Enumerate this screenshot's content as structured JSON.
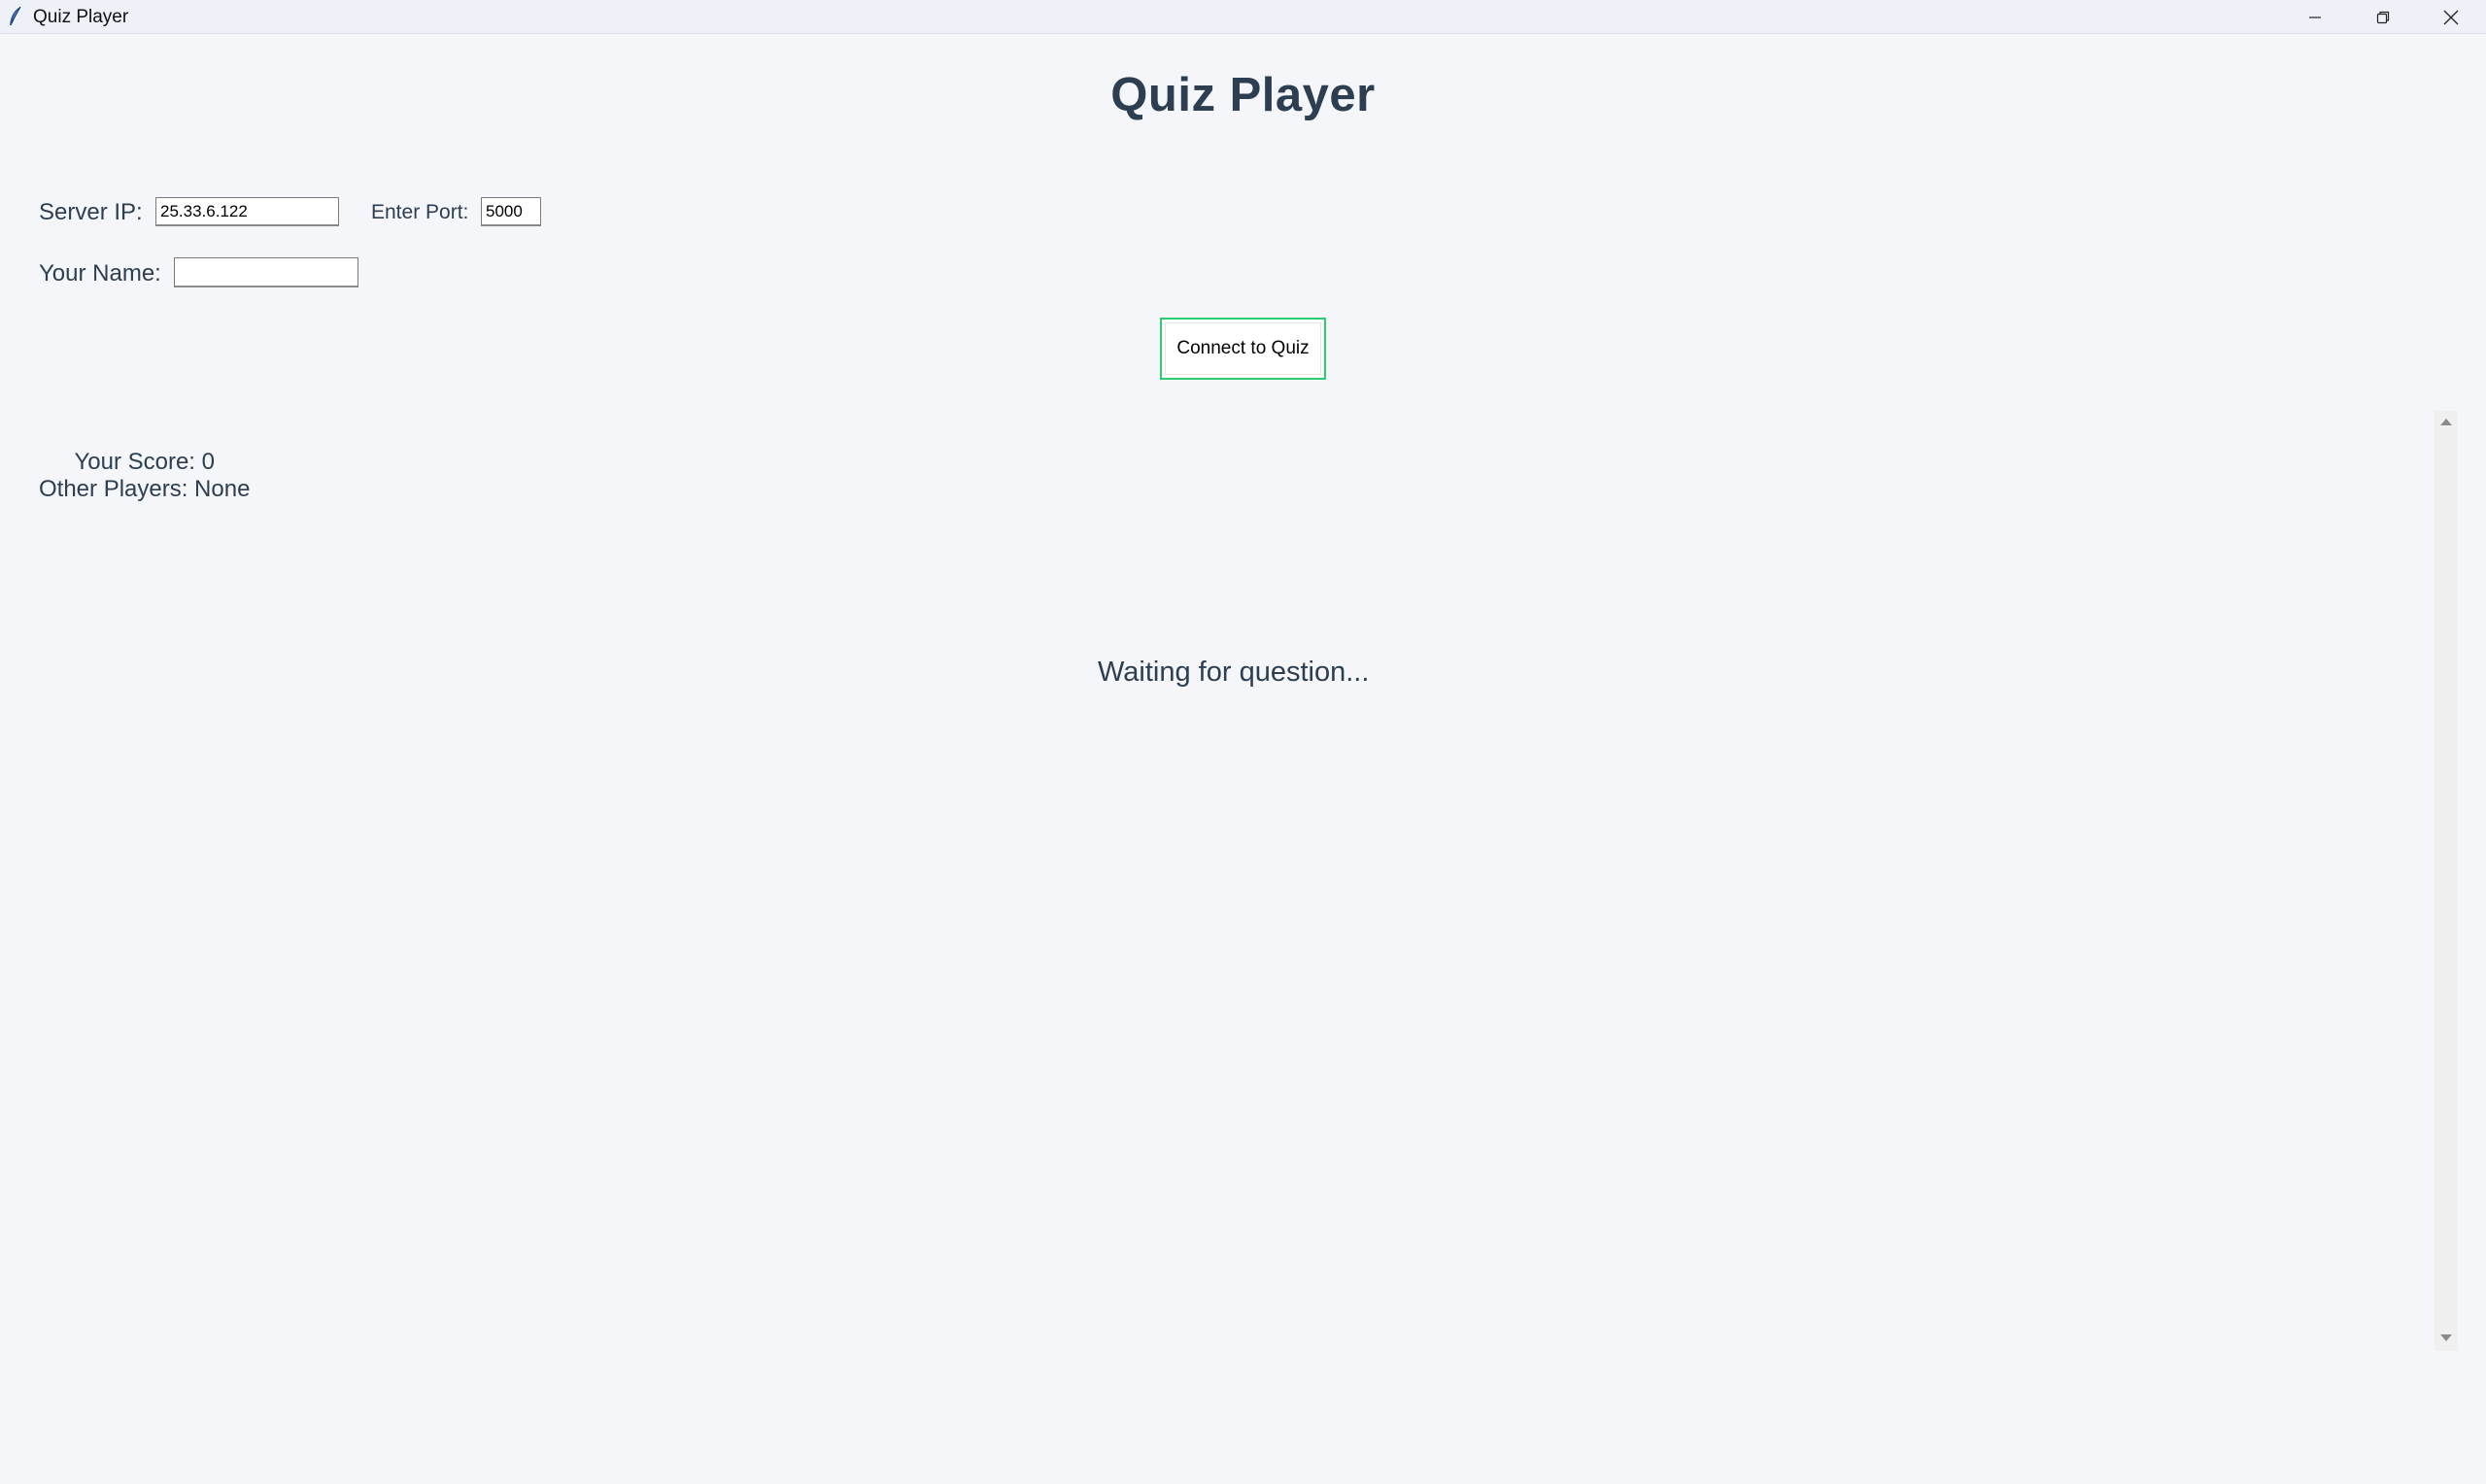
{
  "window": {
    "title": "Quiz Player",
    "icons": {
      "app": "feather-icon",
      "minimize": "minimize-icon",
      "maximize": "restore-icon",
      "close": "close-icon"
    }
  },
  "header": {
    "title": "Quiz Player"
  },
  "connection": {
    "server_ip_label": "Server IP:",
    "server_ip_value": "25.33.6.122",
    "port_label": "Enter Port:",
    "port_value": "5000",
    "name_label": "Your Name:",
    "name_value": "",
    "connect_label": "Connect to Quiz",
    "accent_color": "#2ecc71"
  },
  "scoreboard": {
    "score_text": "Your Score: 0",
    "players_text": "Other Players: None"
  },
  "question": {
    "status_text": "Waiting for question..."
  },
  "colors": {
    "text": "#2c3e50",
    "background": "#f4f6fa"
  }
}
